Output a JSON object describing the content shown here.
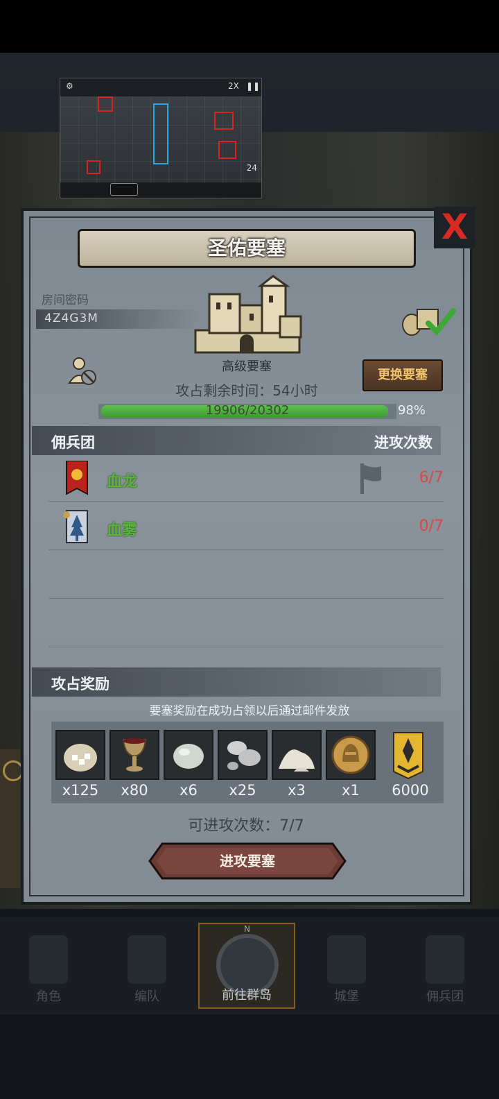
{
  "panel": {
    "title": "圣佑要塞",
    "close_label": "X",
    "room": {
      "label": "房间密码",
      "code": "4Z4G3M"
    },
    "fortress_level": "高级要塞",
    "change_button": "更换要塞",
    "remaining_time": "攻占剩余时间：54小时",
    "progress": {
      "text": "19906/20302",
      "percent_label": "98%",
      "fraction": 0.98
    }
  },
  "mercenary": {
    "header_left": "佣兵团",
    "header_right": "进攻次数",
    "guilds": [
      {
        "name": "血龙",
        "count": "6/7"
      },
      {
        "name": "血雾",
        "count": "0/7"
      }
    ]
  },
  "rewards": {
    "header": "攻占奖励",
    "note": "要塞奖励在成功占领以后通过邮件发放",
    "items": [
      {
        "icon": "sugar-bag-icon",
        "qty": "x125"
      },
      {
        "icon": "goblet-icon",
        "qty": "x80"
      },
      {
        "icon": "pearl-stone-icon",
        "qty": "x6"
      },
      {
        "icon": "mushroom-icon",
        "qty": "x25"
      },
      {
        "icon": "powder-pile-icon",
        "qty": "x3"
      },
      {
        "icon": "knight-coin-icon",
        "qty": "x1"
      },
      {
        "icon": "rank-medal-icon",
        "qty": "6000"
      }
    ]
  },
  "attack": {
    "count_text": "可进攻次数：7/7",
    "button": "进攻要塞"
  },
  "video": {
    "speed": "2X",
    "count": "24"
  },
  "nav": {
    "items": [
      {
        "label": "角色"
      },
      {
        "label": "编队"
      },
      {
        "label": "前往群岛",
        "compass": "N"
      },
      {
        "label": "城堡"
      },
      {
        "label": "佣兵团"
      }
    ]
  },
  "colors": {
    "guild_name": "#5ab43e",
    "count_red": "#d84848",
    "close_red": "#d62a22",
    "progress_green": "#4fae40"
  }
}
